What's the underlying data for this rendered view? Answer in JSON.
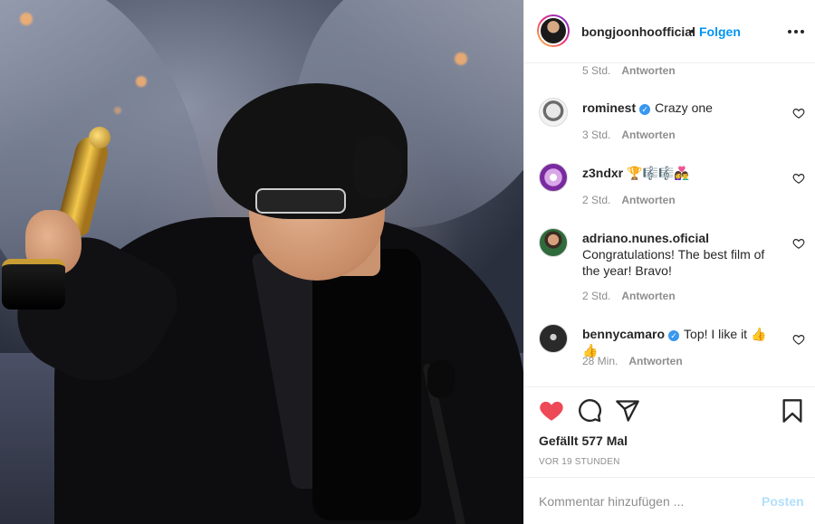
{
  "post": {
    "image_alt": "Photo: man in black tuxedo holding golden Oscar statuette on stage"
  },
  "header": {
    "username": "bongjoonhoofficial",
    "separator": "•",
    "follow_label": "Folgen",
    "more_icon": "more-horizontal-icon"
  },
  "comments": {
    "top_meta": {
      "time": "5 Std.",
      "reply": "Antworten"
    },
    "items": [
      {
        "user": "rominest",
        "verified": true,
        "text": "Crazy one",
        "time": "3 Std.",
        "reply": "Antworten"
      },
      {
        "user": "z3ndxr",
        "verified": false,
        "text": "🏆🎼🎼👩‍❤️‍👨",
        "time": "2 Std.",
        "reply": "Antworten"
      },
      {
        "user": "adriano.nunes.oficial",
        "verified": false,
        "text": "Congratulations! The best film of the year! Bravo!",
        "time": "2 Std.",
        "reply": "Antworten"
      },
      {
        "user": "bennycamaro",
        "verified": true,
        "text": "Top! I like it 👍👍",
        "time": "28 Min.",
        "reply": "Antworten"
      }
    ]
  },
  "actions": {
    "like_icon": "heart-filled-icon",
    "comment_icon": "comment-icon",
    "share_icon": "share-icon",
    "save_icon": "bookmark-icon",
    "likes_text": "Gefällt 577 Mal",
    "posted_ago": "VOR 19 STUNDEN"
  },
  "add_comment": {
    "placeholder": "Kommentar hinzufügen ...",
    "post_label": "Posten"
  },
  "colors": {
    "accent": "#0095f6",
    "like": "#ed4956",
    "muted": "#8e8e8e",
    "post_disabled": "#b2dffc",
    "verified": "#3897f0"
  }
}
